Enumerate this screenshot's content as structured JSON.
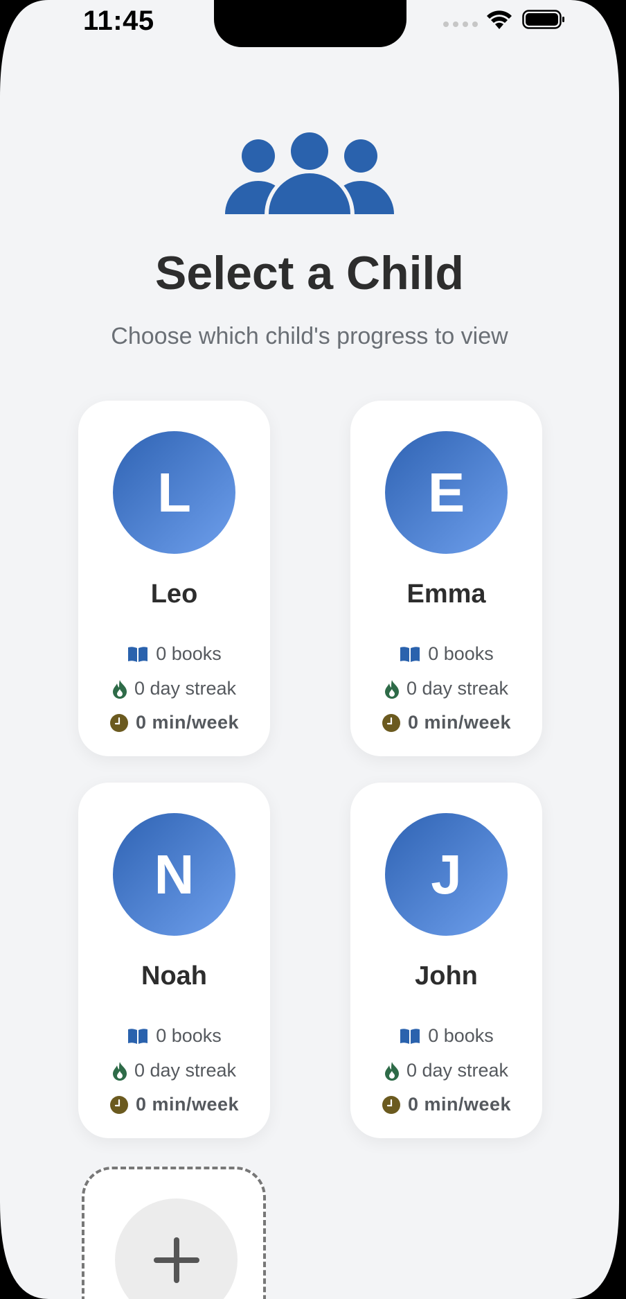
{
  "status_bar": {
    "time": "11:45"
  },
  "header": {
    "icon": "users-icon",
    "title": "Select a Child",
    "subtitle": "Choose which child's progress to view"
  },
  "children": [
    {
      "initial": "L",
      "name": "Leo",
      "books": "0 books",
      "streak": "0 day streak",
      "time": "0 min/week"
    },
    {
      "initial": "E",
      "name": "Emma",
      "books": "0 books",
      "streak": "0 day streak",
      "time": "0 min/week"
    },
    {
      "initial": "N",
      "name": "Noah",
      "books": "0 books",
      "streak": "0 day streak",
      "time": "0 min/week"
    },
    {
      "initial": "J",
      "name": "John",
      "books": "0 books",
      "streak": "0 day streak",
      "time": "0 min/week"
    }
  ],
  "add_child": {
    "icon": "plus-icon"
  },
  "colors": {
    "background": "#f3f4f6",
    "accent": "#2a62ad",
    "avatar_gradient_start": "#2f63b3",
    "avatar_gradient_end": "#6e9fec",
    "streak_icon": "#2e6b48",
    "clock_icon": "#6b5a1f",
    "title_text": "#2d2d2d",
    "secondary_text": "#6a6f75"
  }
}
